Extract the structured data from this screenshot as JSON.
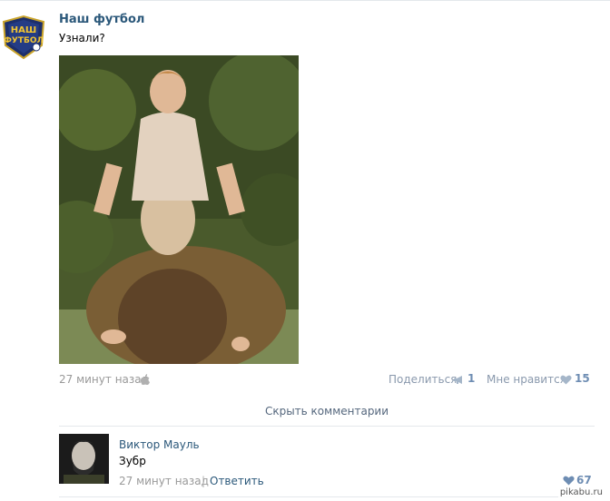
{
  "post": {
    "author": "Наш футбол",
    "logo_text_top": "НАШ",
    "logo_text_bottom": "ФУТБОЛ",
    "text": "Узнали?",
    "time": "27 минут назад",
    "time_icon": "apple-icon",
    "share_label": "Поделиться",
    "share_icon": "megaphone-icon",
    "share_count": "1",
    "like_label": "Мне нравится",
    "like_icon": "heart-icon",
    "like_count": "15"
  },
  "comments": {
    "toggle_label": "Скрыть комментарии",
    "items": [
      {
        "author": "Виктор Мауль",
        "text": "Зубр",
        "time": "27 минут назад",
        "separator": "|",
        "reply_label": "Ответить",
        "like_count": "67"
      }
    ]
  },
  "watermark": "pikabu.ru",
  "colors": {
    "link": "#2b587a",
    "muted": "#999999",
    "action": "#8a99ad",
    "count": "#6e8db3",
    "divider": "#e4e8ec"
  }
}
